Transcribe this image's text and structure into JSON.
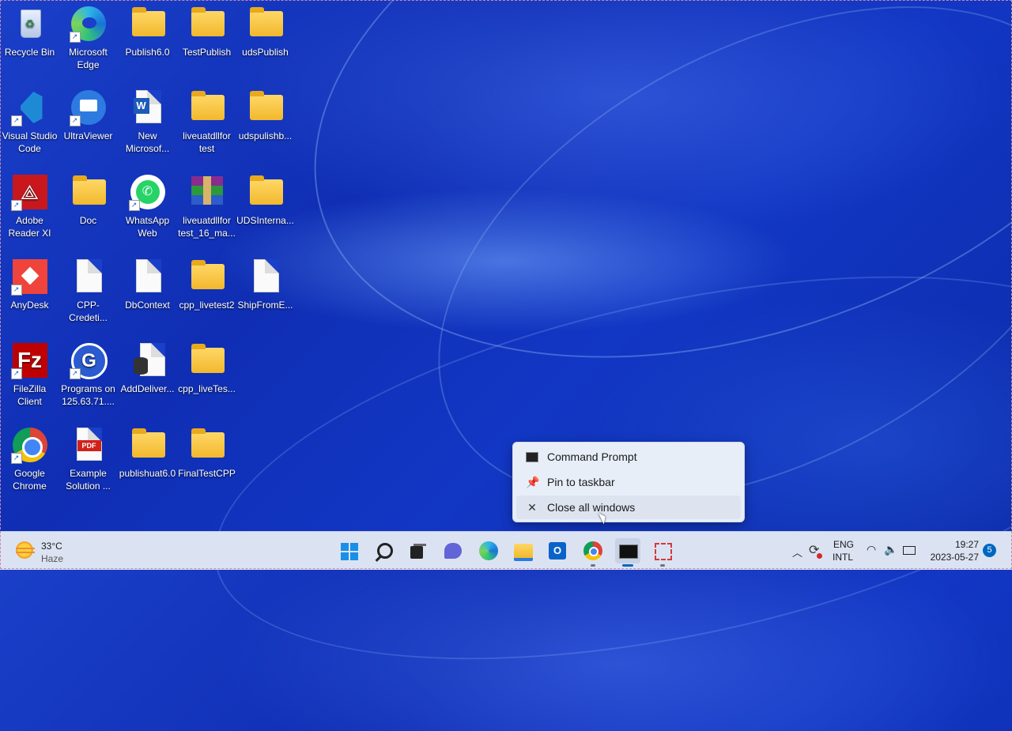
{
  "desktop": {
    "icons": [
      {
        "id": "recycle",
        "label": "Recycle Bin"
      },
      {
        "id": "edge",
        "label": "Microsoft Edge"
      },
      {
        "id": "publish",
        "label": "Publish6.0"
      },
      {
        "id": "testpublish",
        "label": "TestPublish"
      },
      {
        "id": "udspublish",
        "label": "udsPublish"
      },
      {
        "id": "vscode",
        "label": "Visual Studio Code"
      },
      {
        "id": "ultraviewer",
        "label": "UltraViewer"
      },
      {
        "id": "newmsword",
        "label": "New Microsof..."
      },
      {
        "id": "liveuatdll",
        "label": "liveuatdllfor test"
      },
      {
        "id": "udspulishb",
        "label": "udspulishb..."
      },
      {
        "id": "adobe",
        "label": "Adobe Reader XI"
      },
      {
        "id": "doc",
        "label": "Doc"
      },
      {
        "id": "whatsapp",
        "label": "WhatsApp Web"
      },
      {
        "id": "winrar",
        "label": "liveuatdllfor test_16_ma..."
      },
      {
        "id": "udsinterna",
        "label": "UDSInterna..."
      },
      {
        "id": "anydesk",
        "label": "AnyDesk"
      },
      {
        "id": "cppcred",
        "label": "CPP-Credeti..."
      },
      {
        "id": "dbcontext",
        "label": "DbContext"
      },
      {
        "id": "cpplivetest2",
        "label": "cpp_livetest2"
      },
      {
        "id": "shipfrom",
        "label": "ShipFromE..."
      },
      {
        "id": "filezilla",
        "label": "FileZilla Client"
      },
      {
        "id": "programs",
        "label": "Programs on 125.63.71...."
      },
      {
        "id": "adddeliver",
        "label": "AddDeliver..."
      },
      {
        "id": "cpplivetes",
        "label": "cpp_liveTes..."
      },
      {
        "id": "chrome",
        "label": "Google Chrome"
      },
      {
        "id": "example",
        "label": "Example Solution ..."
      },
      {
        "id": "publishuat",
        "label": "publishuat6.0"
      },
      {
        "id": "finaltest",
        "label": "FinalTestCPP"
      }
    ]
  },
  "context_menu": {
    "items": [
      {
        "label": "Command Prompt",
        "icon": "cmd-icon"
      },
      {
        "label": "Pin to taskbar",
        "icon": "pin-icon"
      },
      {
        "label": "Close all windows",
        "icon": "close-icon"
      }
    ]
  },
  "taskbar": {
    "weather": {
      "temp": "33°C",
      "condition": "Haze"
    },
    "apps": [
      "start",
      "search",
      "task-view",
      "teams",
      "edge",
      "file-explorer",
      "outlook",
      "chrome",
      "terminal",
      "snipping-tool"
    ],
    "lang_top": "ENG",
    "lang_bottom": "INTL",
    "time": "19:27",
    "date": "2023-05-27",
    "notification_count": "5"
  },
  "colors": {
    "accent": "#0067c0",
    "wallpaper": "#1a3fc8",
    "taskbar": "#dbe3f3"
  }
}
